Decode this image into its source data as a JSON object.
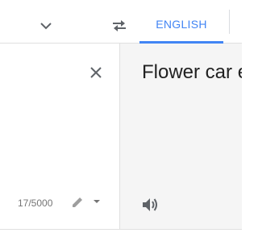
{
  "header": {
    "source_language_dropdown_icon": "chevron-down-icon",
    "swap_icon": "swap-arrows-icon",
    "target_language_tab": "ENGLISH",
    "accent_color": "#4285f4"
  },
  "source": {
    "char_count": "17/5000",
    "clear_icon": "close-icon",
    "edit_icon": "pencil-icon",
    "edit_menu_icon": "triangle-down-icon"
  },
  "target": {
    "translation": "Flower car e",
    "listen_icon": "speaker-icon",
    "background_color": "#f5f5f5"
  }
}
